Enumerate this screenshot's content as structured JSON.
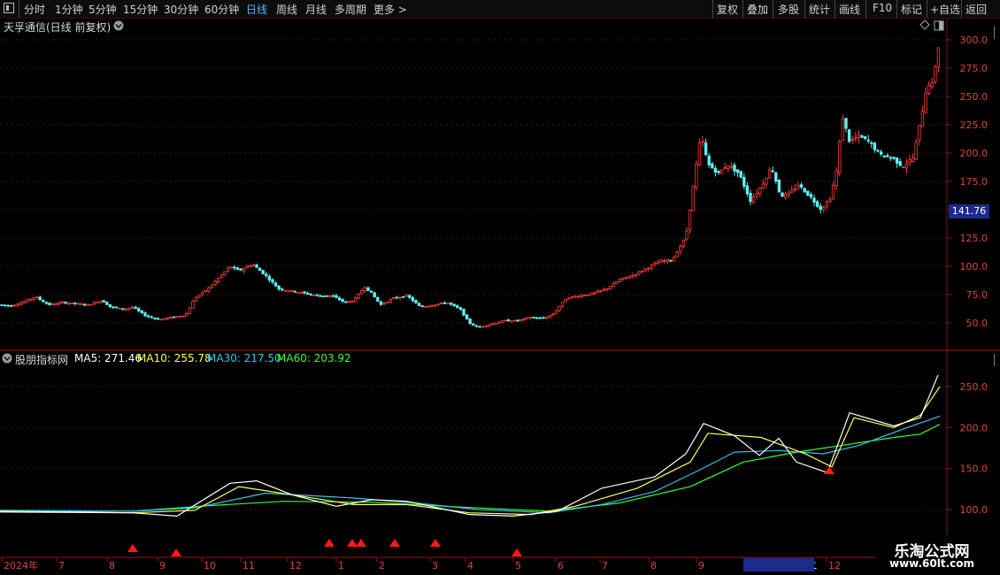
{
  "toolbar": {
    "left_items": [
      "分时",
      "1分钟",
      "5分钟",
      "15分钟",
      "30分钟",
      "60分钟",
      "日线",
      "周线",
      "月线",
      "多周期",
      "更多 >"
    ],
    "active": "日线",
    "right_items": [
      "复权",
      "叠加",
      "多股",
      "统计",
      "画线",
      "F10",
      "标记",
      "+自选",
      "返回"
    ]
  },
  "main_chart": {
    "title": "天孚通信(日线 前复权)",
    "price_ticks": [
      "300.0",
      "275.0",
      "250.0",
      "225.0",
      "200.0",
      "175.0",
      "150.0",
      "125.0",
      "100.0",
      "75.0",
      "50.0"
    ],
    "current_price_label": "141.76"
  },
  "indicator": {
    "name": "股朋指标网",
    "ma5": "MA5: 271.46",
    "ma10": "MA10: 255.78",
    "ma30": "MA30: 217.50",
    "ma60": "MA60: 203.92",
    "ticks": [
      "250.0",
      "200.0",
      "150.0",
      "100.0"
    ]
  },
  "date_axis": {
    "labels": [
      "2024年",
      "7",
      "8",
      "9",
      "10",
      "11",
      "12",
      "1",
      "2",
      "3",
      "4",
      "5",
      "6",
      "7",
      "8",
      "9",
      "2025/09/30/二",
      "12"
    ]
  },
  "watermark": {
    "title": "乐淘公式网",
    "url": "www.60lt.com"
  },
  "colors": {
    "up": "#ff3b3b",
    "down": "#5ff0f0",
    "ma5": "#ffffff",
    "ma10": "#ffff55",
    "ma30": "#33c4e8",
    "ma60": "#33ff33",
    "grid": "#5a0c0c",
    "signal": "#ff1a1a"
  },
  "chart_data": {
    "type": "candlestick",
    "price_ylim": [
      40,
      310
    ],
    "price_series": [
      [
        0,
        66
      ],
      [
        12,
        65
      ],
      [
        25,
        68
      ],
      [
        40,
        73
      ],
      [
        55,
        66
      ],
      [
        70,
        68
      ],
      [
        85,
        67
      ],
      [
        100,
        66
      ],
      [
        115,
        70
      ],
      [
        125,
        64
      ],
      [
        140,
        62
      ],
      [
        150,
        64
      ],
      [
        165,
        56
      ],
      [
        180,
        53
      ],
      [
        195,
        55
      ],
      [
        210,
        57
      ],
      [
        220,
        72
      ],
      [
        235,
        80
      ],
      [
        250,
        92
      ],
      [
        260,
        100
      ],
      [
        270,
        96
      ],
      [
        285,
        102
      ],
      [
        300,
        92
      ],
      [
        315,
        80
      ],
      [
        330,
        78
      ],
      [
        345,
        76
      ],
      [
        360,
        74
      ],
      [
        375,
        74
      ],
      [
        390,
        68
      ],
      [
        400,
        70
      ],
      [
        412,
        82
      ],
      [
        420,
        76
      ],
      [
        430,
        66
      ],
      [
        445,
        72
      ],
      [
        460,
        74
      ],
      [
        475,
        64
      ],
      [
        490,
        66
      ],
      [
        505,
        68
      ],
      [
        520,
        62
      ],
      [
        530,
        50
      ],
      [
        540,
        46
      ],
      [
        555,
        49
      ],
      [
        570,
        52
      ],
      [
        585,
        52
      ],
      [
        600,
        55
      ],
      [
        615,
        54
      ],
      [
        625,
        58
      ],
      [
        640,
        72
      ],
      [
        655,
        74
      ],
      [
        670,
        76
      ],
      [
        685,
        80
      ],
      [
        700,
        88
      ],
      [
        715,
        92
      ],
      [
        730,
        98
      ],
      [
        745,
        104
      ],
      [
        760,
        106
      ],
      [
        775,
        126
      ],
      [
        785,
        180
      ],
      [
        792,
        216
      ],
      [
        800,
        190
      ],
      [
        812,
        182
      ],
      [
        822,
        190
      ],
      [
        835,
        182
      ],
      [
        848,
        158
      ],
      [
        860,
        170
      ],
      [
        872,
        188
      ],
      [
        882,
        162
      ],
      [
        892,
        164
      ],
      [
        902,
        172
      ],
      [
        915,
        162
      ],
      [
        928,
        150
      ],
      [
        938,
        160
      ],
      [
        945,
        182
      ],
      [
        952,
        232
      ],
      [
        960,
        210
      ],
      [
        970,
        215
      ],
      [
        982,
        210
      ],
      [
        995,
        198
      ],
      [
        1008,
        196
      ],
      [
        1020,
        188
      ],
      [
        1032,
        196
      ],
      [
        1040,
        228
      ],
      [
        1048,
        262
      ],
      [
        1054,
        260
      ],
      [
        1060,
        296
      ],
      [
        1063,
        280
      ]
    ],
    "indicator_ylim": [
      80,
      290
    ],
    "ma5": [
      [
        0,
        97
      ],
      [
        150,
        96
      ],
      [
        200,
        92
      ],
      [
        260,
        132
      ],
      [
        290,
        135
      ],
      [
        330,
        118
      ],
      [
        380,
        104
      ],
      [
        420,
        112
      ],
      [
        460,
        110
      ],
      [
        530,
        94
      ],
      [
        580,
        92
      ],
      [
        630,
        98
      ],
      [
        680,
        126
      ],
      [
        740,
        140
      ],
      [
        775,
        168
      ],
      [
        795,
        205
      ],
      [
        830,
        190
      ],
      [
        858,
        166
      ],
      [
        880,
        187
      ],
      [
        900,
        158
      ],
      [
        935,
        145
      ],
      [
        960,
        218
      ],
      [
        1010,
        202
      ],
      [
        1040,
        212
      ],
      [
        1060,
        264
      ]
    ],
    "ma10": [
      [
        0,
        98
      ],
      [
        150,
        96
      ],
      [
        220,
        99
      ],
      [
        270,
        128
      ],
      [
        330,
        118
      ],
      [
        400,
        106
      ],
      [
        460,
        106
      ],
      [
        530,
        96
      ],
      [
        600,
        94
      ],
      [
        650,
        104
      ],
      [
        720,
        126
      ],
      [
        780,
        158
      ],
      [
        800,
        193
      ],
      [
        860,
        188
      ],
      [
        910,
        168
      ],
      [
        940,
        152
      ],
      [
        965,
        212
      ],
      [
        1010,
        200
      ],
      [
        1040,
        215
      ],
      [
        1062,
        250
      ]
    ],
    "ma30": [
      [
        0,
        99
      ],
      [
        150,
        98
      ],
      [
        220,
        102
      ],
      [
        300,
        120
      ],
      [
        400,
        114
      ],
      [
        470,
        108
      ],
      [
        540,
        100
      ],
      [
        620,
        96
      ],
      [
        680,
        106
      ],
      [
        740,
        122
      ],
      [
        790,
        148
      ],
      [
        830,
        170
      ],
      [
        880,
        172
      ],
      [
        930,
        168
      ],
      [
        970,
        178
      ],
      [
        1020,
        198
      ],
      [
        1062,
        214
      ]
    ],
    "ma60": [
      [
        0,
        98
      ],
      [
        150,
        98
      ],
      [
        240,
        105
      ],
      [
        320,
        110
      ],
      [
        420,
        109
      ],
      [
        520,
        103
      ],
      [
        620,
        98
      ],
      [
        700,
        108
      ],
      [
        780,
        128
      ],
      [
        840,
        158
      ],
      [
        900,
        170
      ],
      [
        950,
        178
      ],
      [
        1010,
        188
      ],
      [
        1040,
        192
      ],
      [
        1062,
        204
      ]
    ],
    "signals_x": [
      150,
      199,
      372,
      398,
      408,
      446,
      492,
      584,
      937
    ]
  }
}
